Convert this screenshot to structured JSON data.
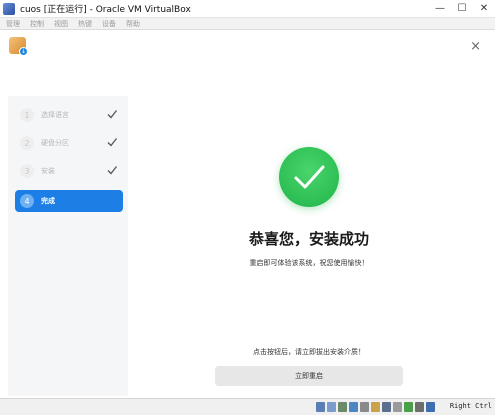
{
  "window": {
    "title": "cuos [正在运行] - Oracle VM VirtualBox",
    "minimize_glyph": "—",
    "maximize_glyph": "☐",
    "close_glyph": "✕"
  },
  "menu": [
    "管理",
    "控制",
    "视图",
    "热键",
    "设备",
    "帮助"
  ],
  "installer": {
    "close_glyph": "×",
    "steps": [
      {
        "number": "1",
        "label": "选择语言",
        "done": true
      },
      {
        "number": "2",
        "label": "硬盘分区",
        "done": true
      },
      {
        "number": "3",
        "label": "安装",
        "done": true
      },
      {
        "number": "4",
        "label": "完成",
        "active": true
      }
    ],
    "success_title": "恭喜您，安装成功",
    "success_message": "重启即可体验该系统，祝您使用愉快！",
    "hint": "点击按钮后，请立即拔出安装介质！",
    "reboot_button": "立即重启"
  },
  "statusbar": {
    "host_key": "Right Ctrl",
    "icons": [
      "hdd-icon",
      "optical-drive-icon",
      "audio-icon",
      "network-icon",
      "usb-icon",
      "shared-folder-icon",
      "display-icon",
      "recording-icon",
      "cpu-icon",
      "mouse-integration-icon",
      "keyboard-icon"
    ]
  },
  "colors": {
    "accent": "#1d7fe6",
    "success": "#2fc356"
  }
}
